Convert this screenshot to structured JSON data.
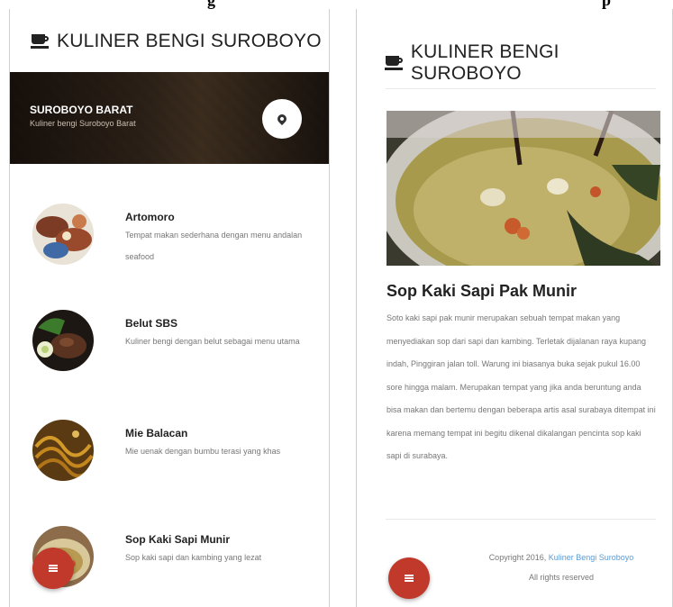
{
  "captions": {
    "left": "g",
    "right": "p"
  },
  "app": {
    "title": "KULINER BENGI SUROBOYO"
  },
  "hero": {
    "title": "SUROBOYO BARAT",
    "subtitle": "Kuliner bengi Suroboyo Barat"
  },
  "list": [
    {
      "title": "Artomoro",
      "desc": "Tempat makan sederhana dengan menu andalan seafood"
    },
    {
      "title": "Belut SBS",
      "desc": "Kuliner bengi dengan belut sebagai menu utama"
    },
    {
      "title": "Mie Balacan",
      "desc": "Mie uenak dengan bumbu terasi yang khas"
    },
    {
      "title": "Sop Kaki Sapi Munir",
      "desc": "Sop kaki sapi dan kambing yang lezat"
    }
  ],
  "detail": {
    "title": "Sop Kaki Sapi Pak Munir",
    "body": "Soto kaki sapi pak munir merupakan sebuah tempat makan yang menyediakan sop dari sapi dan kambing. Terletak dijalanan raya kupang indah, Pinggiran jalan toll. Warung ini biasanya buka sejak pukul 16.00 sore hingga malam. Merupakan tempat yang jika anda beruntung anda bisa makan dan bertemu dengan beberapa artis asal surabaya ditempat ini karena memang tempat ini begitu dikenal dikalangan pencinta sop kaki sapi di surabaya."
  },
  "footer": {
    "copyright": "Copyright 2016,",
    "link": "Kuliner Bengi Suroboyo",
    "rights": "All rights reserved"
  },
  "icons": {
    "app": "coffee-cup-icon",
    "location": "map-pin-icon",
    "menu": "menu-icon"
  },
  "colors": {
    "fab": "#c0392b",
    "link": "#5b9bd5"
  }
}
